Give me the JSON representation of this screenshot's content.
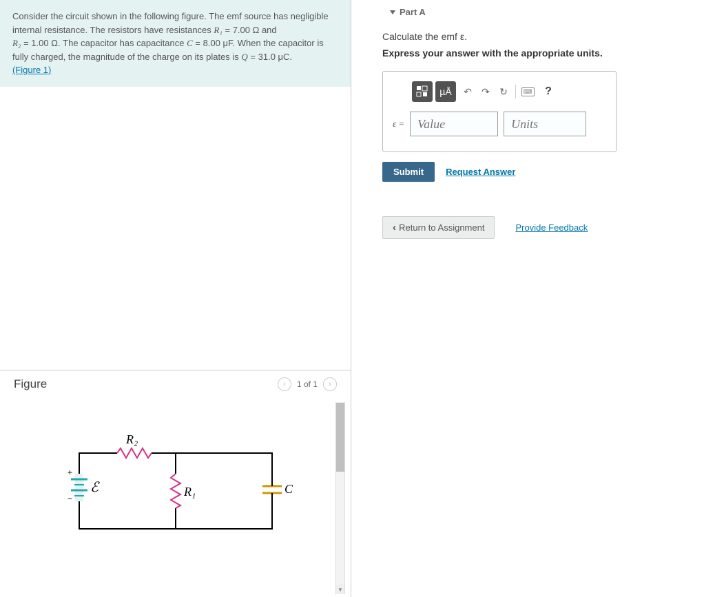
{
  "problem": {
    "text_pre": "Consider the circuit shown in the following figure. The emf source has negligible internal resistance. The resistors have resistances ",
    "R1_sym": "R₁",
    "R1_val": " = 7.00 Ω",
    "and": " and ",
    "R2_sym": "R₂",
    "R2_val": " = 1.00 Ω",
    "cap_pre": ". The capacitor has capacitance ",
    "C_sym": "C",
    "C_val": " = 8.00 μF",
    "charge_pre": ". When the capacitor is fully charged, the magnitude of the charge on its plates is ",
    "Q_sym": "Q",
    "Q_val": " = 31.0 μC",
    "post": ".",
    "figure_link": "(Figure 1)"
  },
  "figure": {
    "title": "Figure",
    "nav_text": "1 of 1",
    "labels": {
      "emf": "ℰ",
      "R1": "R₁",
      "R2": "R₂",
      "C": "C"
    }
  },
  "part": {
    "header": "Part A",
    "question": "Calculate the emf ε.",
    "instruction": "Express your answer with the appropriate units."
  },
  "toolbar": {
    "templates": "x□",
    "special": "µÅ",
    "undo": "↶",
    "redo": "↷",
    "reset": "↻",
    "keyboard": "⌨",
    "help": "?"
  },
  "answer": {
    "label": "ε =",
    "value_placeholder": "Value",
    "units_placeholder": "Units"
  },
  "actions": {
    "submit": "Submit",
    "request_answer": "Request Answer",
    "return": "Return to Assignment",
    "feedback": "Provide Feedback"
  }
}
